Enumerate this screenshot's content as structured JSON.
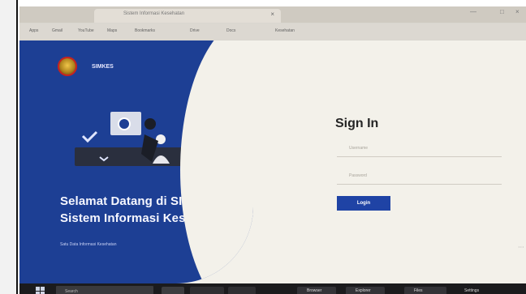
{
  "browser": {
    "tab_title": "Sistem Informasi Kesehatan"
  },
  "bookmarks": {
    "items": [
      "Apps",
      "Gmail",
      "YouTube",
      "Maps",
      "Bookmarks",
      "Drive",
      "Docs",
      "Kesehatan"
    ]
  },
  "app": {
    "name": "SIMKES"
  },
  "hero": {
    "title_line_1": "Selamat Datang di SIMKES,",
    "title_line_2": "Sistem Informasi Kesehatan",
    "subtitle": "Satu Data Informasi Kesehatan"
  },
  "login": {
    "title": "Sign In",
    "username_placeholder": "Username",
    "password_placeholder": "Password",
    "button_label": "Login"
  },
  "taskbar": {
    "search_placeholder": "Search",
    "items": [
      "Browser",
      "Explorer",
      "Files",
      "Settings"
    ]
  },
  "colors": {
    "left_panel": "#1d3f94",
    "login_button": "#1f43a5",
    "page_background": "#f3f1ea"
  }
}
